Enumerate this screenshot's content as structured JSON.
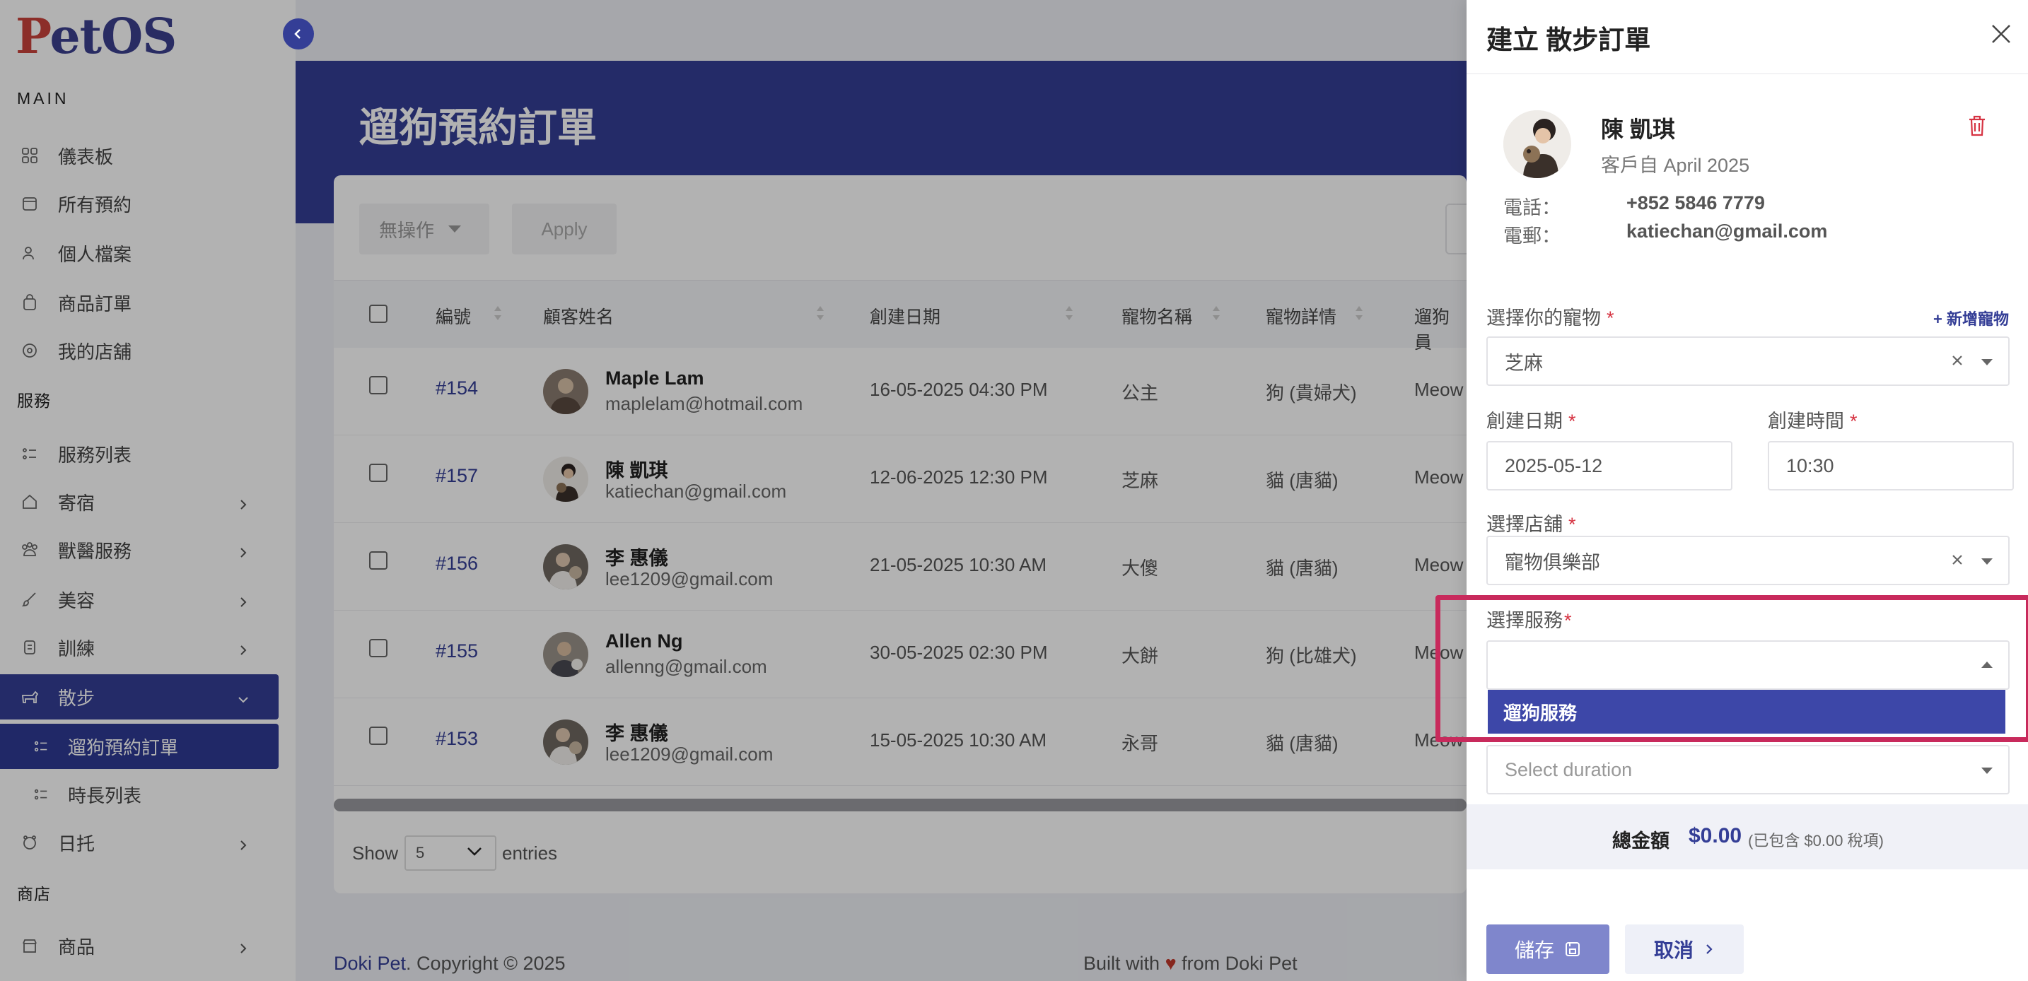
{
  "app": {
    "logo_p": "P",
    "logo_rest": "etOS"
  },
  "sidebar": {
    "section_main": "MAIN",
    "section_services": "服務",
    "section_shop": "商店",
    "items": [
      {
        "label": "儀表板",
        "icon": "grid-icon"
      },
      {
        "label": "所有預約",
        "icon": "calendar-icon"
      },
      {
        "label": "個人檔案",
        "icon": "user-icon"
      },
      {
        "label": "商品訂單",
        "icon": "bag-icon"
      },
      {
        "label": "我的店舖",
        "icon": "store-icon"
      },
      {
        "label": "服務列表",
        "icon": "list-icon"
      },
      {
        "label": "寄宿",
        "icon": "home-icon"
      },
      {
        "label": "獸醫服務",
        "icon": "vet-icon"
      },
      {
        "label": "美容",
        "icon": "brush-icon"
      },
      {
        "label": "訓練",
        "icon": "training-icon"
      },
      {
        "label": "散步",
        "icon": "dog-walk-icon"
      },
      {
        "label": "遛狗預約訂單",
        "icon": "list-icon"
      },
      {
        "label": "時長列表",
        "icon": "list-icon"
      },
      {
        "label": "日托",
        "icon": "daycare-icon"
      },
      {
        "label": "商品",
        "icon": "shop-icon"
      }
    ]
  },
  "main": {
    "title": "遛狗預約訂單",
    "bulk_action": "無操作",
    "apply": "Apply",
    "columns": [
      "編號",
      "顧客姓名",
      "創建日期",
      "寵物名稱",
      "寵物詳情",
      "遛狗員"
    ],
    "rows": [
      {
        "id": "#154",
        "name": "Maple Lam",
        "email": "maplelam@hotmail.com",
        "date": "16-05-2025 04:30 PM",
        "pet": "公主",
        "detail": "狗 (貴婦犬)",
        "walker": "Meow"
      },
      {
        "id": "#157",
        "name": "陳 凱琪",
        "email": "katiechan@gmail.com",
        "date": "12-06-2025 12:30 PM",
        "pet": "芝麻",
        "detail": "貓 (唐貓)",
        "walker": "Meow"
      },
      {
        "id": "#156",
        "name": "李 惠儀",
        "email": "lee1209@gmail.com",
        "date": "21-05-2025 10:30 AM",
        "pet": "大傻",
        "detail": "貓 (唐貓)",
        "walker": "Meow"
      },
      {
        "id": "#155",
        "name": "Allen Ng",
        "email": "allenng@gmail.com",
        "date": "30-05-2025 02:30 PM",
        "pet": "大餅",
        "detail": "狗 (比雄犬)",
        "walker": "Meow"
      },
      {
        "id": "#153",
        "name": "李 惠儀",
        "email": "lee1209@gmail.com",
        "date": "15-05-2025 10:30 AM",
        "pet": "永哥",
        "detail": "貓 (唐貓)",
        "walker": "Meow"
      }
    ],
    "show": "Show",
    "entries_value": "5",
    "entries": "entries"
  },
  "footer": {
    "brand": "Doki Pet",
    "copyright": ". Copyright © 2025",
    "built_with": "Built with",
    "from": "from Doki Pet"
  },
  "panel": {
    "title": "建立 散步訂單",
    "customer": {
      "name": "陳 凱琪",
      "since": "客戶自 April 2025",
      "phone_label": "電話：",
      "phone": "+852 5846 7779",
      "email_label": "電郵：",
      "email": "katiechan@gmail.com"
    },
    "pet_label": "選擇你的寵物",
    "add_pet": "+ 新增寵物",
    "pet_value": "芝麻",
    "date_label": "創建日期",
    "date_value": "2025-05-12",
    "time_label": "創建時間",
    "time_value": "10:30",
    "store_label": "選擇店舖",
    "store_value": "寵物俱樂部",
    "service_label": "選擇服務",
    "service_option": "遛狗服務",
    "duration_placeholder": "Select duration",
    "total_label": "總金額",
    "total_value": "$0.00",
    "total_tax": "(已包含 $0.00 稅項)",
    "save": "儲存",
    "cancel": "取消",
    "required_mark": "*"
  },
  "colors": {
    "primary": "#343e96",
    "highlight": "#c82a5c",
    "required": "#d63342",
    "logo_red": "#c9423b"
  }
}
